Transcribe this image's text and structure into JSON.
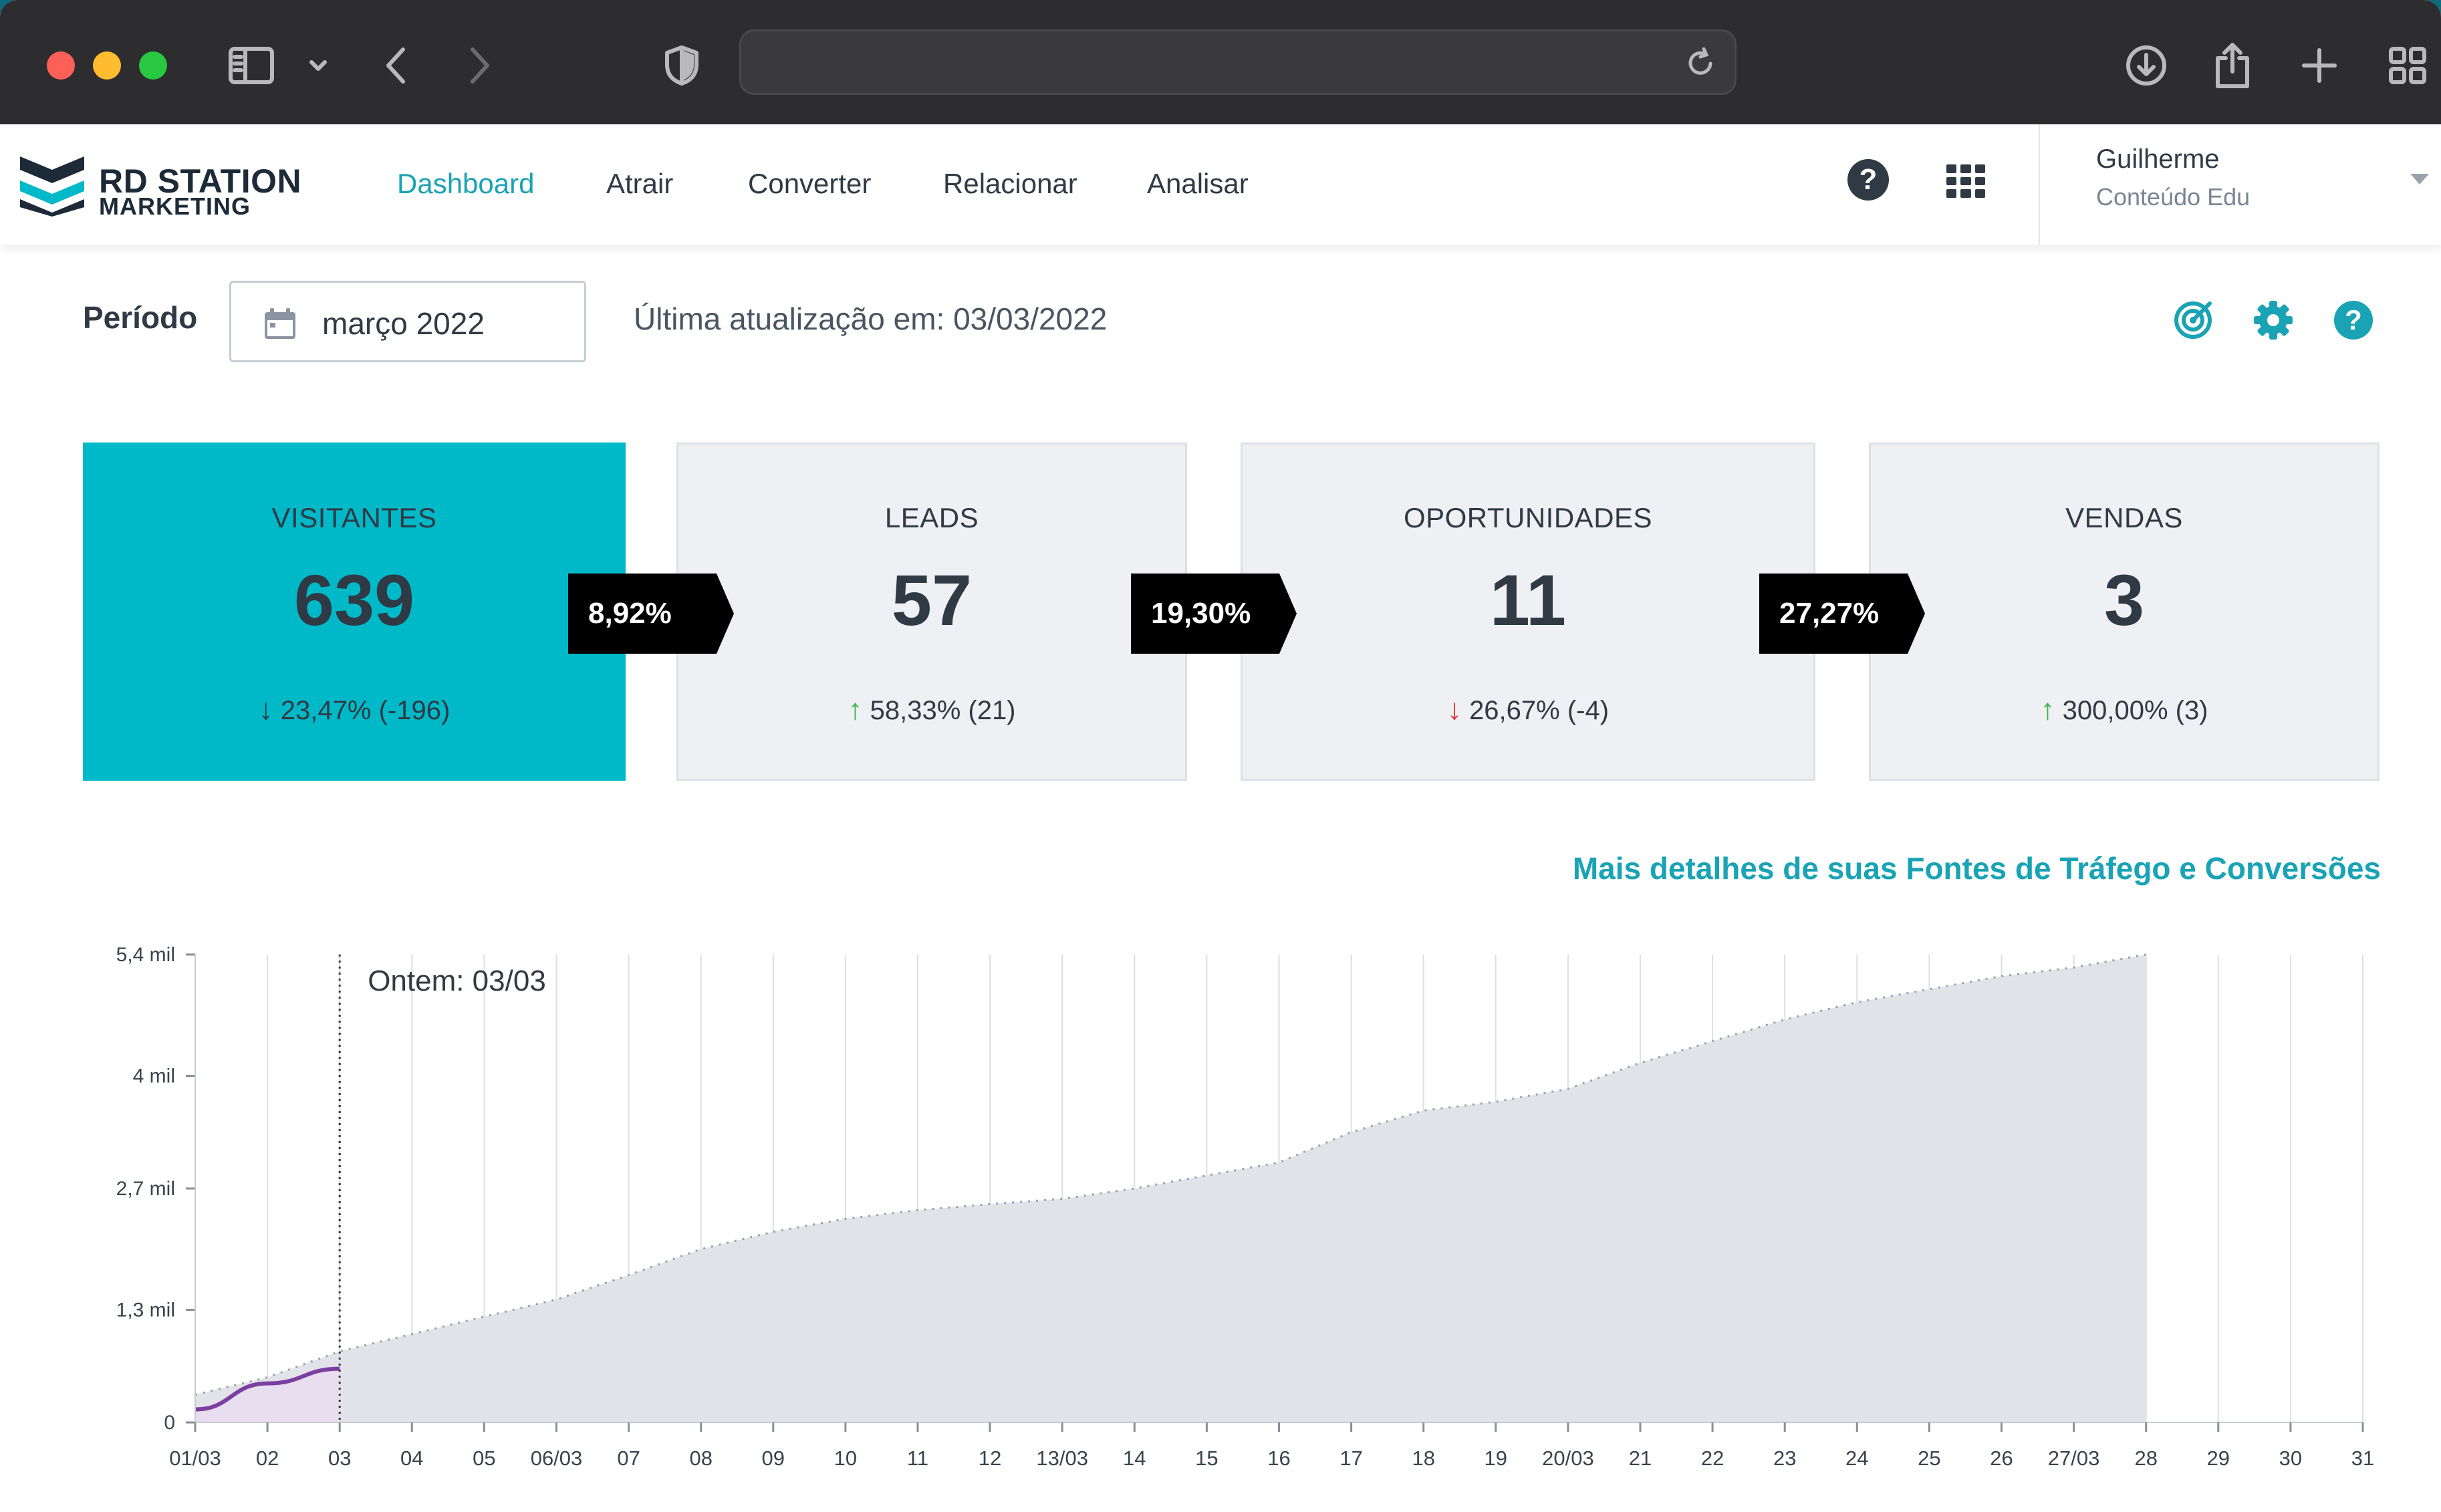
{
  "browser": {
    "icons": [
      "sidebar-icon",
      "chevron-down-icon",
      "back-icon",
      "forward-icon",
      "shield-icon",
      "reload-icon",
      "download-icon",
      "share-icon",
      "plus-icon",
      "tabs-overview-icon"
    ]
  },
  "app": {
    "logo_title": "RD STATION",
    "logo_subtitle": "MARKETING",
    "nav": [
      {
        "label": "Dashboard",
        "active": true
      },
      {
        "label": "Atrair",
        "active": false
      },
      {
        "label": "Converter",
        "active": false
      },
      {
        "label": "Relacionar",
        "active": false
      },
      {
        "label": "Analisar",
        "active": false
      }
    ],
    "help_glyph": "?",
    "user": {
      "name": "Guilherme",
      "org": "Conteúdo Edu"
    }
  },
  "filters": {
    "period_label": "Período",
    "period_value": "março 2022",
    "last_update": "Última atualização em: 03/03/2022"
  },
  "funnel": {
    "cards": [
      {
        "label": "VISITANTES",
        "value": "639",
        "change": "23,47% (-196)",
        "direction": "down"
      },
      {
        "label": "LEADS",
        "value": "57",
        "change": "58,33% (21)",
        "direction": "up"
      },
      {
        "label": "OPORTUNIDADES",
        "value": "11",
        "change": "26,67% (-4)",
        "direction": "down"
      },
      {
        "label": "VENDAS",
        "value": "3",
        "change": "300,00% (3)",
        "direction": "up"
      }
    ],
    "rates": [
      "8,92%",
      "19,30%",
      "27,27%"
    ],
    "colors": {
      "highlight": "#00b9c8",
      "up": "#3bb54a",
      "down": "#e5323c"
    }
  },
  "details_link": "Mais detalhes de suas Fontes de Tráfego e Conversões",
  "chart_data": {
    "type": "area",
    "annotation": "Ontem: 03/03",
    "y_ticks": [
      "0",
      "1,3 mil",
      "2,7 mil",
      "4 mil",
      "5,4 mil"
    ],
    "ylim": [
      0,
      5400
    ],
    "x": [
      "01/03",
      "02",
      "03",
      "04",
      "05",
      "06/03",
      "07",
      "08",
      "09",
      "10",
      "11",
      "12",
      "13/03",
      "14",
      "15",
      "16",
      "17",
      "18",
      "19",
      "20/03",
      "21",
      "22",
      "23",
      "24",
      "25",
      "26",
      "27/03",
      "28",
      "29",
      "30",
      "31"
    ],
    "series": [
      {
        "values": [
          320,
          520,
          820,
          1020,
          1220,
          1420,
          1700,
          2000,
          2200,
          2350,
          2450,
          2520,
          2580,
          2700,
          2850,
          3000,
          3350,
          3600,
          3700,
          3850,
          4150,
          4400,
          4650,
          4850,
          5000,
          5150,
          5250,
          5400
        ]
      },
      {
        "values": [
          150,
          450,
          620
        ]
      }
    ]
  }
}
